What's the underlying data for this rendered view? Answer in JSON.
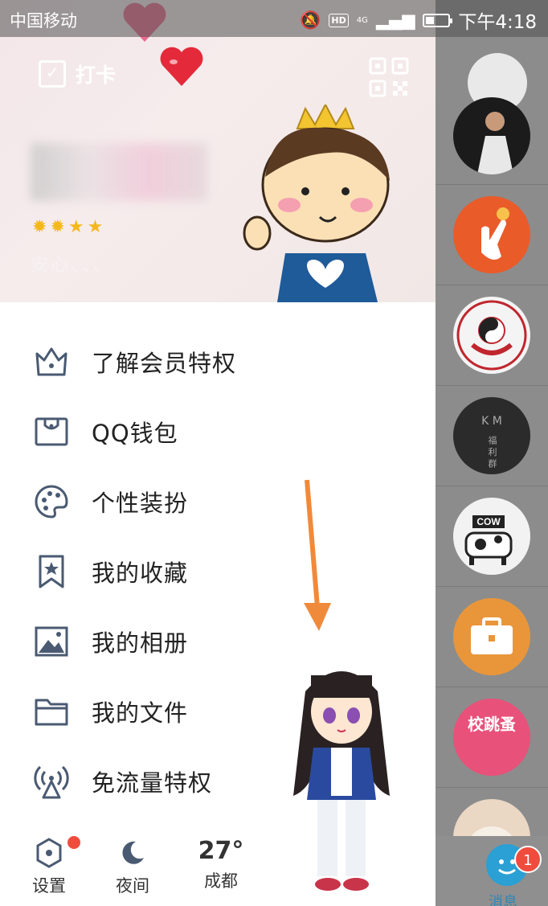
{
  "status_bar": {
    "carrier": "中国移动",
    "time": "下午4:18",
    "hd": "HD",
    "network": "4G"
  },
  "header": {
    "checkin_label": "打卡",
    "signature": "安心、、、",
    "level_stars": 4
  },
  "menu": {
    "items": [
      {
        "label": "了解会员特权",
        "icon": "crown-icon"
      },
      {
        "label": "QQ钱包",
        "icon": "wallet-icon"
      },
      {
        "label": "个性装扮",
        "icon": "palette-icon"
      },
      {
        "label": "我的收藏",
        "icon": "bookmark-star-icon"
      },
      {
        "label": "我的相册",
        "icon": "image-icon"
      },
      {
        "label": "我的文件",
        "icon": "folder-icon"
      },
      {
        "label": "免流量特权",
        "icon": "antenna-icon"
      }
    ]
  },
  "bottom_bar": {
    "settings_label": "设置",
    "night_label": "夜间",
    "temperature": "27°",
    "city": "成都"
  },
  "right_panel": {
    "avatars": [
      {
        "name": "profile-photo"
      },
      {
        "name": "hand-logo",
        "color": "#ea5b2a"
      },
      {
        "name": "university-seal"
      },
      {
        "name": "km-group",
        "text_top": "K M",
        "text_bottom": "福 利 群"
      },
      {
        "name": "cow-logo",
        "text": "COW"
      },
      {
        "name": "briefcase-logo",
        "color": "#e9963a"
      },
      {
        "name": "xiaotiaozao",
        "text": "校跳蚤",
        "color": "#e8517a"
      },
      {
        "name": "cat-photo"
      }
    ],
    "messages_label": "消息",
    "messages_badge": "1"
  },
  "colors": {
    "accent_blue": "#2aa0d4",
    "badge_red": "#f04c3e",
    "arrow_orange": "#f08a3b"
  }
}
